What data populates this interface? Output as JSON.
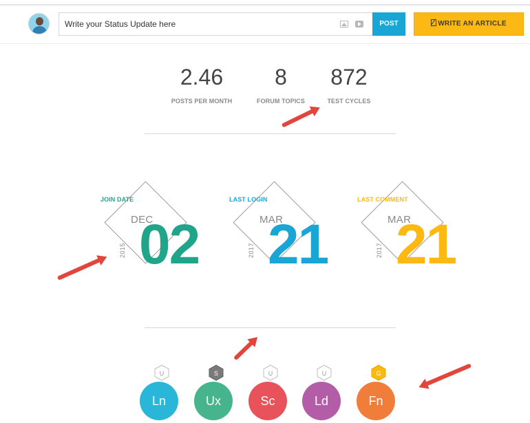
{
  "composer": {
    "placeholder": "Write your Status Update here",
    "post_label": "POST",
    "write_article_label": "WRITE AN ARTICLE"
  },
  "stats": [
    {
      "value": "2.46",
      "label": "POSTS PER MONTH"
    },
    {
      "value": "8",
      "label": "FORUM TOPICS"
    },
    {
      "value": "872",
      "label": "TEST CYCLES"
    }
  ],
  "dates": [
    {
      "label": "JOIN DATE",
      "month": "DEC",
      "year": "2015",
      "day": "02",
      "color": "#21a58a"
    },
    {
      "label": "LAST LOGIN",
      "month": "MAR",
      "year": "2017",
      "day": "21",
      "color": "#1aa6d4"
    },
    {
      "label": "LAST COMMENT",
      "month": "MAR",
      "year": "2017",
      "day": "21",
      "color": "#fdb913"
    }
  ],
  "badges": [
    {
      "abbr": "Ln",
      "color": "#29b6d9",
      "tier": "U",
      "tier_fill": "#ffffff",
      "tier_stroke": "#bdbdbd",
      "tier_text": "#999999"
    },
    {
      "abbr": "Ux",
      "color": "#46b58d",
      "tier": "S",
      "tier_fill": "#7a7a7a",
      "tier_stroke": "#5e5e5e",
      "tier_text": "#ffffff"
    },
    {
      "abbr": "Sc",
      "color": "#e8525a",
      "tier": "U",
      "tier_fill": "#ffffff",
      "tier_stroke": "#bdbdbd",
      "tier_text": "#999999"
    },
    {
      "abbr": "Ld",
      "color": "#b35ca8",
      "tier": "U",
      "tier_fill": "#ffffff",
      "tier_stroke": "#bdbdbd",
      "tier_text": "#999999"
    },
    {
      "abbr": "Fn",
      "color": "#f07d3a",
      "tier": "G",
      "tier_fill": "#fdb913",
      "tier_stroke": "#e9a400",
      "tier_text": "#ffffff"
    }
  ],
  "annotation_color": "#e2453c"
}
